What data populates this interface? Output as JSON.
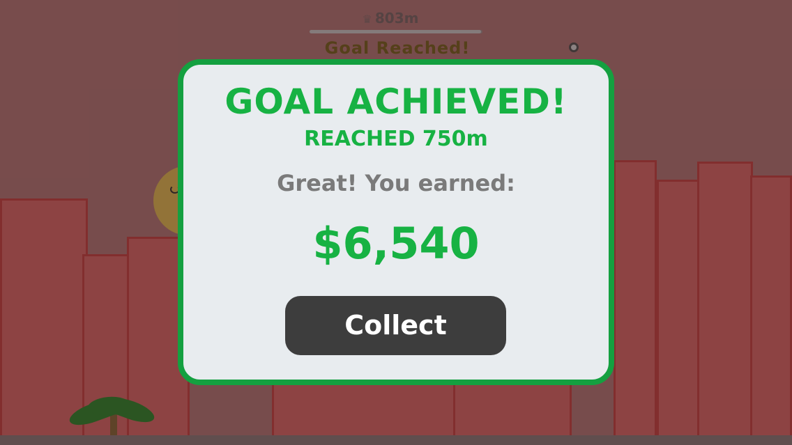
{
  "hud": {
    "best_distance": "803m",
    "goal_label": "Goal Reached!",
    "progress": 0.99
  },
  "modal": {
    "title": "GOAL ACHIEVED!",
    "subtitle": "REACHED 750m",
    "earned_label": "Great! You earned:",
    "amount": "$6,540",
    "collect_label": "Collect"
  },
  "colors": {
    "accent_green": "#17b243",
    "modal_border": "#14a040",
    "button": "#3d3d3d"
  }
}
